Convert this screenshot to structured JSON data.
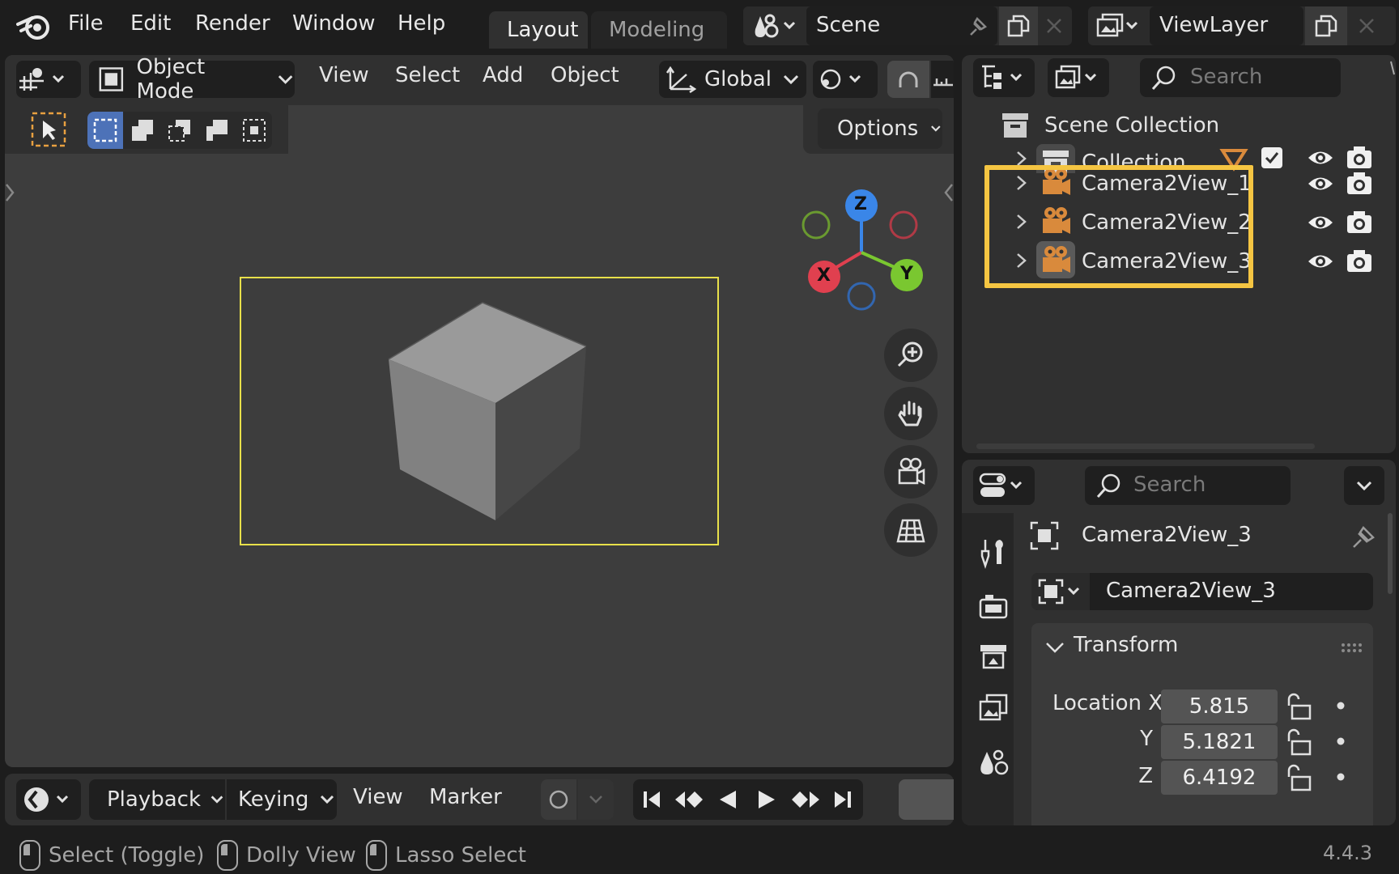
{
  "topbar": {
    "menus": [
      "File",
      "Edit",
      "Render",
      "Window",
      "Help"
    ],
    "workspace_tabs": [
      "Layout",
      "Modeling"
    ],
    "scene_name": "Scene",
    "view_layer_name": "ViewLayer"
  },
  "viewport": {
    "mode": "Object Mode",
    "menus": [
      "View",
      "Select",
      "Add",
      "Object"
    ],
    "orientation": "Global",
    "options_label": "Options",
    "gizmo_axes": {
      "z": "Z",
      "x": "X",
      "y": "Y"
    }
  },
  "timeline": {
    "playback": "Playback",
    "keying": "Keying",
    "view": "View",
    "marker": "Marker"
  },
  "outliner": {
    "search_placeholder": "Search",
    "scene_collection": "Scene Collection",
    "collection": "Collection",
    "items": [
      "Camera2View_1",
      "Camera2View_2",
      "Camera2View_3"
    ]
  },
  "properties": {
    "search_placeholder": "Search",
    "object_name": "Camera2View_3",
    "data_name": "Camera2View_3",
    "panel_title": "Transform",
    "location_label": "Location X",
    "y_label": "Y",
    "z_label": "Z",
    "location": [
      "5.815",
      "5.1821",
      "6.4192"
    ]
  },
  "statusbar": {
    "select": "Select (Toggle)",
    "dolly": "Dolly View",
    "lasso": "Lasso Select",
    "version": "4.4.3"
  },
  "colors": {
    "highlight_box": "#f5c542",
    "camera_frame": "#e8e04a",
    "axis_x": "#e0404f",
    "axis_y": "#7ac730",
    "axis_z": "#3a86e8",
    "camera_icon": "#d98a3c"
  }
}
